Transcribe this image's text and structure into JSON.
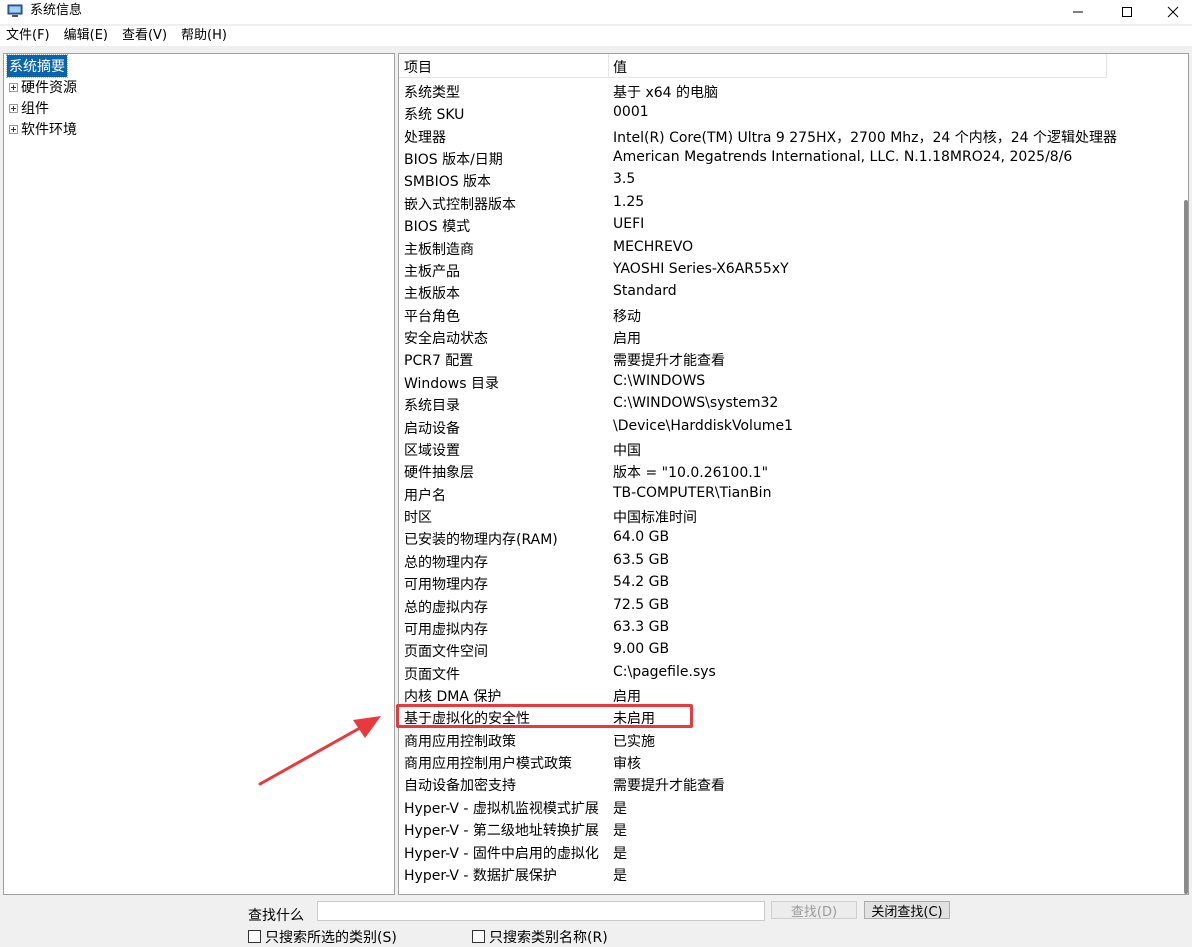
{
  "window": {
    "title": "系统信息",
    "controls": [
      "minimize-icon",
      "maximize-icon",
      "close-icon"
    ]
  },
  "menu": {
    "items": [
      {
        "label": "文件(F)"
      },
      {
        "label": "编辑(E)"
      },
      {
        "label": "查看(V)"
      },
      {
        "label": "帮助(H)"
      }
    ]
  },
  "tree": {
    "items": [
      {
        "label": "系统摘要",
        "selected": true,
        "expandable": false
      },
      {
        "label": "硬件资源",
        "selected": false,
        "expandable": true
      },
      {
        "label": "组件",
        "selected": false,
        "expandable": true
      },
      {
        "label": "软件环境",
        "selected": false,
        "expandable": true
      }
    ]
  },
  "list": {
    "headers": {
      "item": "项目",
      "value": "值"
    },
    "rows": [
      {
        "item": "系统类型",
        "value": "基于 x64 的电脑"
      },
      {
        "item": "系统 SKU",
        "value": "0001"
      },
      {
        "item": "处理器",
        "value": "Intel(R) Core(TM) Ultra 9 275HX，2700 Mhz，24 个内核，24 个逻辑处理器"
      },
      {
        "item": "BIOS 版本/日期",
        "value": "American Megatrends International, LLC. N.1.18MRO24, 2025/8/6"
      },
      {
        "item": "SMBIOS 版本",
        "value": "3.5"
      },
      {
        "item": "嵌入式控制器版本",
        "value": "1.25"
      },
      {
        "item": "BIOS 模式",
        "value": "UEFI"
      },
      {
        "item": "主板制造商",
        "value": "MECHREVO"
      },
      {
        "item": "主板产品",
        "value": "YAOSHI Series-X6AR55xY"
      },
      {
        "item": "主板版本",
        "value": "Standard"
      },
      {
        "item": "平台角色",
        "value": "移动"
      },
      {
        "item": "安全启动状态",
        "value": "启用"
      },
      {
        "item": "PCR7 配置",
        "value": "需要提升才能查看"
      },
      {
        "item": "Windows 目录",
        "value": "C:\\WINDOWS"
      },
      {
        "item": "系统目录",
        "value": "C:\\WINDOWS\\system32"
      },
      {
        "item": "启动设备",
        "value": "\\Device\\HarddiskVolume1"
      },
      {
        "item": "区域设置",
        "value": "中国"
      },
      {
        "item": "硬件抽象层",
        "value": "版本 = \"10.0.26100.1\""
      },
      {
        "item": "用户名",
        "value": "TB-COMPUTER\\TianBin"
      },
      {
        "item": "时区",
        "value": "中国标准时间"
      },
      {
        "item": "已安装的物理内存(RAM)",
        "value": "64.0 GB"
      },
      {
        "item": "总的物理内存",
        "value": "63.5 GB"
      },
      {
        "item": "可用物理内存",
        "value": "54.2 GB"
      },
      {
        "item": "总的虚拟内存",
        "value": "72.5 GB"
      },
      {
        "item": "可用虚拟内存",
        "value": "63.3 GB"
      },
      {
        "item": "页面文件空间",
        "value": "9.00 GB"
      },
      {
        "item": "页面文件",
        "value": "C:\\pagefile.sys"
      },
      {
        "item": "内核 DMA 保护",
        "value": "启用"
      },
      {
        "item": "基于虚拟化的安全性",
        "value": "未启用",
        "highlighted": true
      },
      {
        "item": "商用应用控制政策",
        "value": "已实施"
      },
      {
        "item": "商用应用控制用户模式政策",
        "value": "审核"
      },
      {
        "item": "自动设备加密支持",
        "value": "需要提升才能查看"
      },
      {
        "item": "Hyper-V - 虚拟机监视模式扩展",
        "value": "是"
      },
      {
        "item": "Hyper-V - 第二级地址转换扩展",
        "value": "是"
      },
      {
        "item": "Hyper-V - 固件中启用的虚拟化",
        "value": "是"
      },
      {
        "item": "Hyper-V - 数据扩展保护",
        "value": "是"
      }
    ]
  },
  "find": {
    "label": "查找什么",
    "input_value": "",
    "find_button": "查找(D)",
    "close_button": "关闭查找(C)",
    "option1": "只搜索所选的类别(S)",
    "option2": "只搜索类别名称(R)"
  },
  "colors": {
    "annotation": "#e8393e",
    "selection": "#0a64ad"
  }
}
